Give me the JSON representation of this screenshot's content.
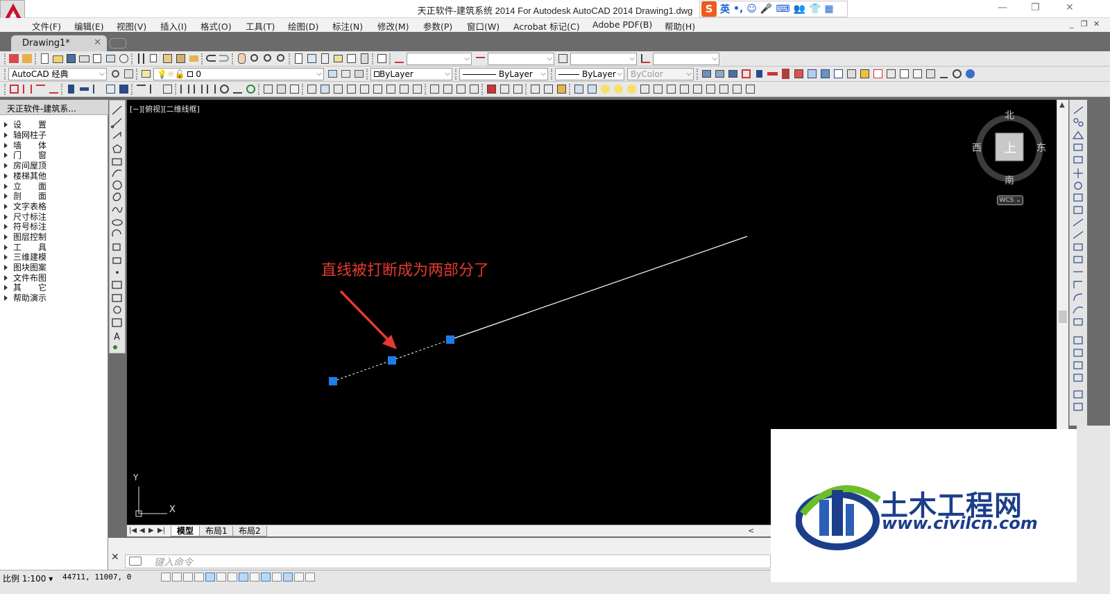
{
  "window": {
    "title": "天正软件-建筑系统 2014  For Autodesk AutoCAD 2014    Drawing1.dwg",
    "controls": [
      "—",
      "❐",
      "✕"
    ]
  },
  "ime": {
    "lang": "英",
    "punct": "•,",
    "items": [
      "☺",
      "🎤",
      "⌨",
      "👥",
      "👕",
      "▦"
    ]
  },
  "menu": [
    "文件(F)",
    "编辑(E)",
    "视图(V)",
    "插入(I)",
    "格式(O)",
    "工具(T)",
    "绘图(D)",
    "标注(N)",
    "修改(M)",
    "参数(P)",
    "窗口(W)",
    "Acrobat 标记(C)",
    "Adobe PDF(B)",
    "帮助(H)"
  ],
  "mdi_controls": [
    "_",
    "❐",
    "✕"
  ],
  "doc_tab": {
    "label": "Drawing1*",
    "close": "✕"
  },
  "toolbar": {
    "workspace": "AutoCAD 经典",
    "layer": "0",
    "color": "ByLayer",
    "linetype": "ByLayer",
    "lineweight": "ByLayer",
    "plotstyle": "ByColor"
  },
  "left_panel": {
    "title": "天正软件-建筑系...",
    "items": [
      "设　　置",
      "轴网柱子",
      "墙　　体",
      "门　　窗",
      "房间屋顶",
      "楼梯其他",
      "立　　面",
      "剖　　面",
      "文字表格",
      "尺寸标注",
      "符号标注",
      "图层控制",
      "工　　具",
      "三维建模",
      "图块图案",
      "文件布图",
      "其　　它",
      "帮助演示"
    ]
  },
  "viewport": {
    "label": "[−][俯视][二维线框]",
    "annotation": "直线被打断成为两部分了",
    "compass": {
      "north": "北",
      "south": "南",
      "east": "东",
      "west": "西",
      "top": "上"
    },
    "wcs": "WCS ⌄",
    "ucs": {
      "x": "X",
      "y": "Y"
    },
    "colors": {
      "background": "#000000",
      "line": "#ffffff",
      "grip": "#1e7ee8",
      "annotation": "#e53a2f"
    }
  },
  "layout_tabs": [
    "模型",
    "布局1",
    "布局2"
  ],
  "layout_nav": [
    "|◀",
    "◀",
    "▶",
    "▶|"
  ],
  "command": {
    "placeholder": "键入命令",
    "close": "✕"
  },
  "status": {
    "scale": "比例 1:100 ▾",
    "coords": "44711, 11007, 0"
  },
  "watermark": {
    "cn": "土木工程网",
    "url": "www.civilcn.com"
  }
}
